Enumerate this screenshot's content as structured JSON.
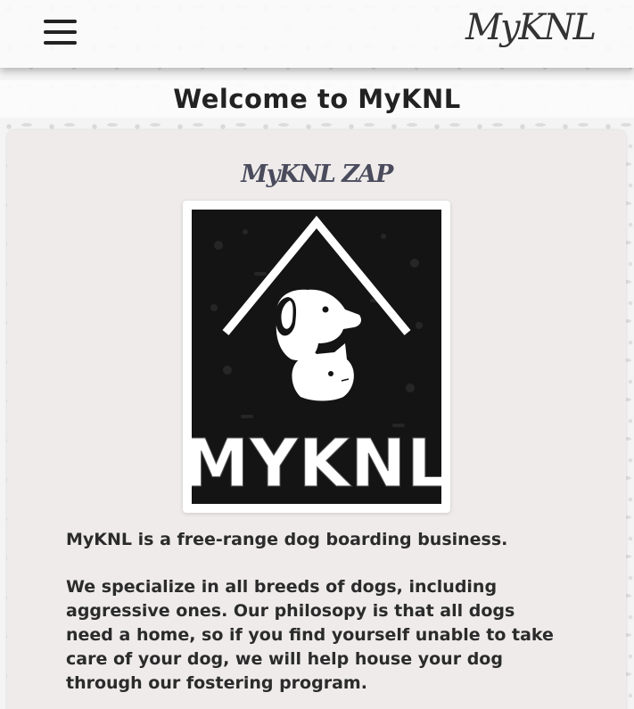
{
  "header": {
    "menu_icon": "hamburger-menu-icon",
    "logo_text": "MyKNL"
  },
  "welcome": {
    "title": "Welcome to MyKNL"
  },
  "card": {
    "heading": "MyKNL ZAP",
    "logo_image": {
      "icon": "dog-and-cat-house-logo",
      "wordmark": "MYKNL"
    },
    "paragraphs": [
      "MyKNL is a free-range dog boarding business.",
      "We specialize in all breeds of dogs, including aggressive ones. Our philosopy is that all dogs need a home, so if you find yourself unable to take care of your dog, we will help house your dog through our fostering program."
    ]
  },
  "colors": {
    "page_background": "#f4f4f4",
    "card_background": "#eeebea",
    "heading_color": "#4a4b5c",
    "logo_background": "#141414",
    "text_color": "#2b2b2b"
  }
}
